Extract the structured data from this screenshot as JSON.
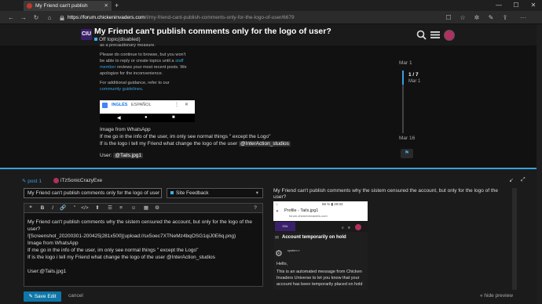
{
  "browser": {
    "tab_title": "My Friend can't publish",
    "tab_close": "✕",
    "new_tab": "+",
    "url_host": "https://forum.chickeninvaders.com",
    "url_path": "/t/my-friend-cant-publish-comments-only-for-the-logo-of-user/6679",
    "win_min": "—",
    "win_max": "☐",
    "win_close": "✕"
  },
  "header": {
    "logo": "CIU",
    "title": "My Friend can't publish comments only for the logo of user?",
    "category": "Off topic(disabled)"
  },
  "post": {
    "notice_1": "as a precautionary measure.",
    "notice_2": "Please do continue to browse, but you won't",
    "notice_3_a": "be able to reply or create topics until a ",
    "notice_3_link": "staff",
    "notice_4_link": "member",
    "notice_4_b": " reviews your most recent posts. We",
    "notice_5": "apologize for the inconvenience.",
    "notice_6": "For additional guidance, refer to our",
    "notice_7_link": "community guidelines",
    "notice_7_b": ".",
    "phone_tab_1": "INGLÉS",
    "phone_tab_2": "ESPAÑOL",
    "line_image": "Image from WhatsApp",
    "line_info": "If me go in the info of the user, im only see normal things \" except the Logo\"",
    "line_logo": "If is the logo i tell my Friend what change the logo of the user ",
    "mention": "@InterAction_studios",
    "line_user": "User: ",
    "user_val": "@Tails.jpg1"
  },
  "timeline": {
    "date_top": "Mar 1",
    "position": "1 / 7",
    "position_date": "Mar 1",
    "date_bottom": "Mar 16",
    "progress": 0.14
  },
  "composer": {
    "reply_to": "post 1",
    "reply_user": "iTzSonicCrazyExe",
    "title_value": "My Friend can't publish comments only for the logo of user",
    "category_value": "Site Feedback",
    "editor_lines": [
      "My Friend can't publish comments why the sistem censured the account, but only for the logo of the",
      "user?",
      "![Screenshot_20200301-200425|281x500](upload://sx5oec7XTNeMz4bqOSG1qiJ0E6q.png)",
      "Image from WhatsApp",
      "If me go in the info of the user, im only see normal things \" except the Logo\"",
      "If is the logo i tell my Friend what change the logo of the user @InterAction_studios",
      "",
      "User:@Tails.jpg1"
    ],
    "save_label": "Save Edit",
    "cancel_label": "cancel",
    "hide_preview_label": "« hide preview"
  },
  "preview": {
    "line_1": "My Friend can't publish comments why the sistem censured the account, but only for the logo of the",
    "line_2": "user?",
    "status": "56 % ▮ 20:04",
    "profile_title": "Profile - Tails.jpg1",
    "profile_url": "forum.chickeninvaders.com",
    "hold_title": "Account temporarily on hold",
    "system_label": "system ◐",
    "hello": "Hello,",
    "msg_1": "This is an automated message from Chicken",
    "msg_2": "Invaders Universe to let you know that your",
    "msg_3": "account has been temporarily placed on hold"
  },
  "icons": {
    "search": "search-icon",
    "menu": "hamburger-icon",
    "back": "back-arrow-icon",
    "forward": "forward-arrow-icon",
    "refresh": "refresh-icon",
    "home": "home-icon"
  },
  "colors": {
    "accent": "#3a9fdc",
    "brand": "#3a1f6b",
    "save_button": "#0e76a8"
  }
}
